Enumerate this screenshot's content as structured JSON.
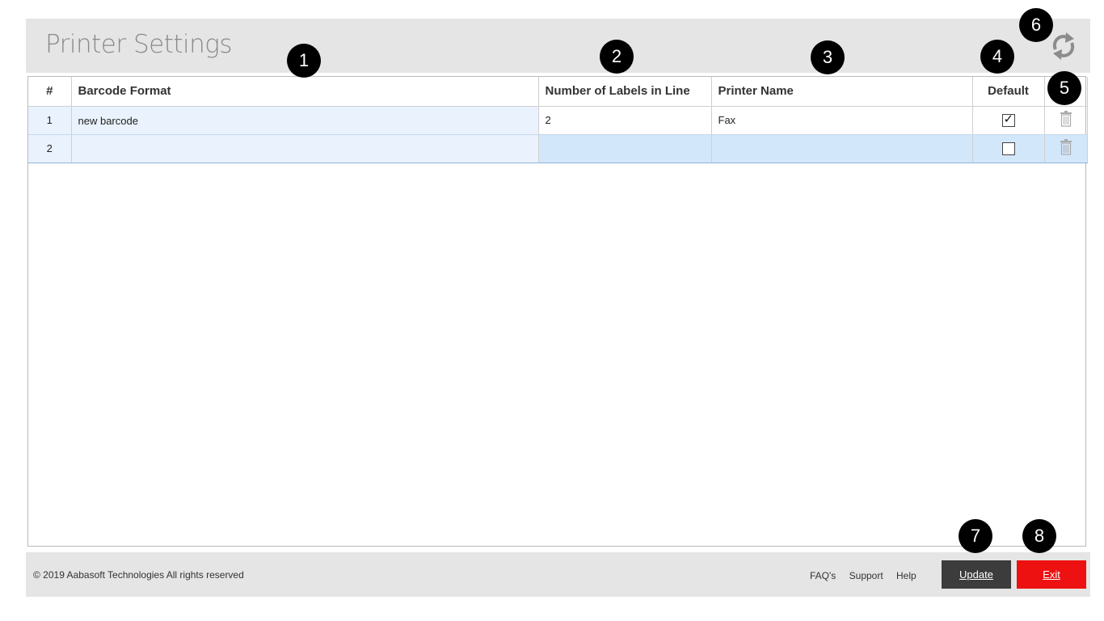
{
  "header": {
    "title": "Printer Settings",
    "refresh_icon": "refresh-icon"
  },
  "table": {
    "columns": [
      "#",
      "Barcode Format",
      "Number of Labels in Line",
      "Printer Name",
      "Default",
      ""
    ],
    "rows": [
      {
        "num": "1",
        "barcode_format": "new barcode",
        "labels_in_line": "2",
        "printer_name": "Fax",
        "default": true
      },
      {
        "num": "2",
        "barcode_format": "",
        "labels_in_line": "",
        "printer_name": "",
        "default": false
      }
    ]
  },
  "callouts": [
    "1",
    "2",
    "3",
    "4",
    "5",
    "6",
    "7",
    "8"
  ],
  "footer": {
    "copyright": "© 2019 Aabasoft Technologies All rights reserved",
    "links": [
      "FAQ's",
      "Support",
      "Help"
    ],
    "update_label": "Update",
    "exit_label": "Exit"
  },
  "colors": {
    "header_bg": "#e5e5e5",
    "selected_row": "#d3e7fb",
    "update_button": "#3c3c3c",
    "exit_button": "#ee1111"
  }
}
